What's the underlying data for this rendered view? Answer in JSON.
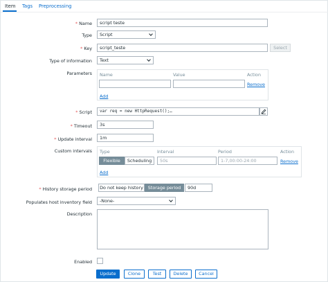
{
  "tabs": [
    "Item",
    "Tags",
    "Preprocessing"
  ],
  "form": {
    "required_mark": "*",
    "name": {
      "label": "Name",
      "value": "script teste"
    },
    "type": {
      "label": "Type",
      "value": "Script"
    },
    "key": {
      "label": "Key",
      "value": "script_teste",
      "select_label": "Select"
    },
    "type_of_information": {
      "label": "Type of information",
      "value": "Text"
    },
    "parameters": {
      "label": "Parameters",
      "headers": [
        "Name",
        "Value",
        "Action"
      ],
      "remove_label": "Remove",
      "add_label": "Add"
    },
    "script": {
      "label": "Script",
      "value": "var req = new HttpRequest();…"
    },
    "timeout": {
      "label": "Timeout",
      "value": "3s"
    },
    "update_interval": {
      "label": "Update interval",
      "value": "1m"
    },
    "custom_intervals": {
      "label": "Custom intervals",
      "headers": [
        "Type",
        "Interval",
        "Period",
        "Action"
      ],
      "type_options": [
        "Flexible",
        "Scheduling"
      ],
      "selected_type": "Flexible",
      "interval_placeholder": "50s",
      "period_placeholder": "1-7,00:00-24:00",
      "remove_label": "Remove",
      "add_label": "Add"
    },
    "history": {
      "label": "History storage period",
      "options": [
        "Do not keep history",
        "Storage period"
      ],
      "selected": "Storage period",
      "value": "90d"
    },
    "inventory": {
      "label": "Populates host inventory field",
      "value": "-None-"
    },
    "description": {
      "label": "Description",
      "value": ""
    },
    "enabled": {
      "label": "Enabled",
      "checked": false
    }
  },
  "actions": [
    "Update",
    "Clone",
    "Test",
    "Delete",
    "Cancel"
  ],
  "colors": {
    "link": "#0a6ecd",
    "required": "#e45959",
    "segment_active": "#768d99"
  }
}
